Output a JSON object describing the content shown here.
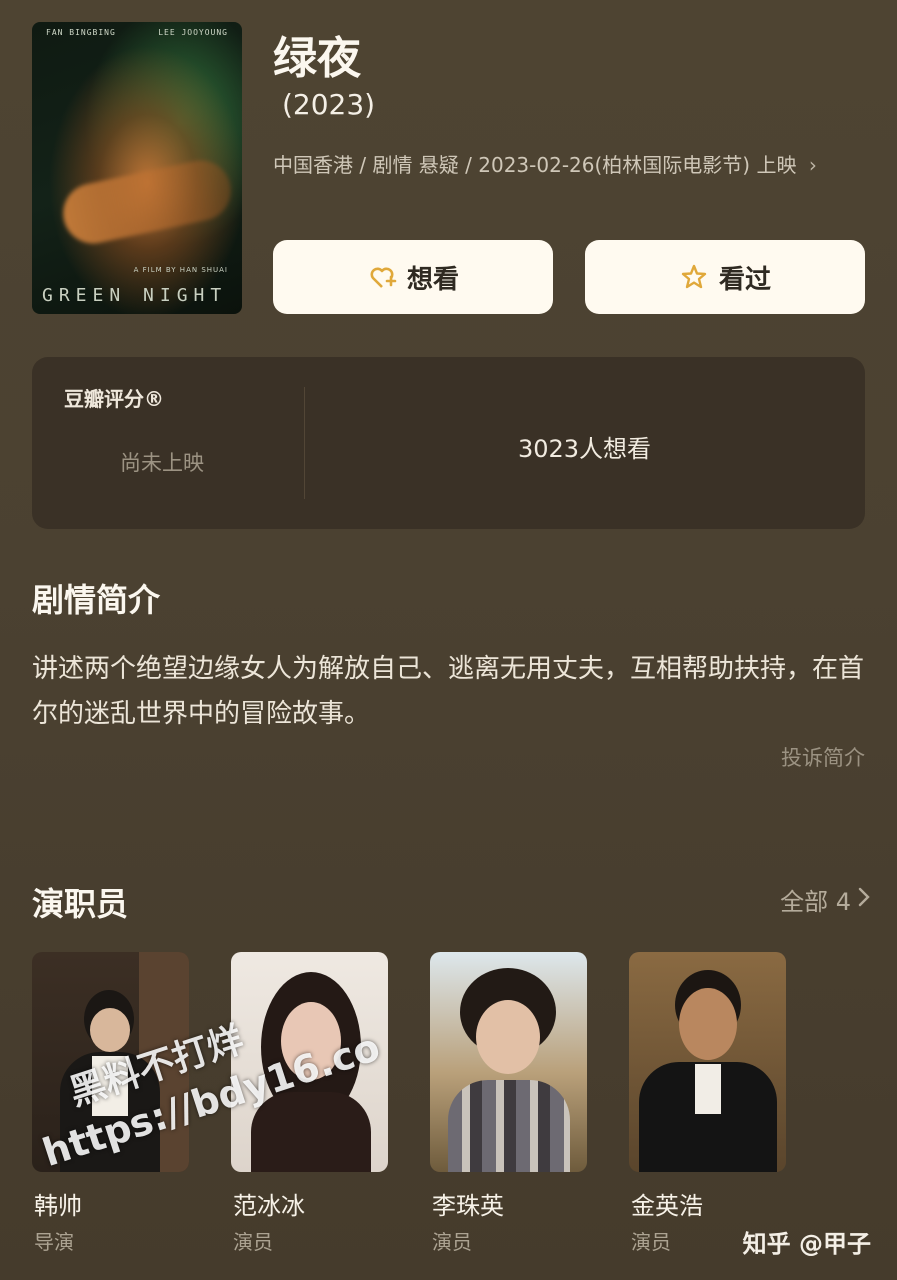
{
  "movie": {
    "title": "绿夜",
    "year": "(2023)",
    "meta": "中国香港 / 剧情 悬疑 / 2023-02-26(柏林国际电影节) 上映",
    "chevron": "›",
    "poster": {
      "credit_left": "FAN BINGBING",
      "credit_right": "LEE JOOYOUNG",
      "byline": "A FILM BY HAN SHUAI",
      "title_text": "GREEN NIGHT"
    }
  },
  "actions": {
    "want_label": "想看",
    "seen_label": "看过",
    "accent": "#e0a83a"
  },
  "rating": {
    "label": "豆瓣评分®",
    "status": "尚未上映",
    "wish_count": "3023人想看"
  },
  "synopsis": {
    "heading": "剧情简介",
    "text": "讲述两个绝望边缘女人为解放自己、逃离无用丈夫，互相帮助扶持，在首尔的迷乱世界中的冒险故事。",
    "report": "投诉简介"
  },
  "cast": {
    "heading": "演职员",
    "all_label": "全部 4",
    "members": [
      {
        "name": "韩帅",
        "role": "导演"
      },
      {
        "name": "范冰冰",
        "role": "演员"
      },
      {
        "name": "李珠英",
        "role": "演员"
      },
      {
        "name": "金英浩",
        "role": "演员"
      }
    ]
  },
  "overlay": {
    "watermark_line1": "黑料不打烊",
    "watermark_line2": "https://bdy16.co",
    "zhihu_tag": "知乎 @甲子"
  }
}
